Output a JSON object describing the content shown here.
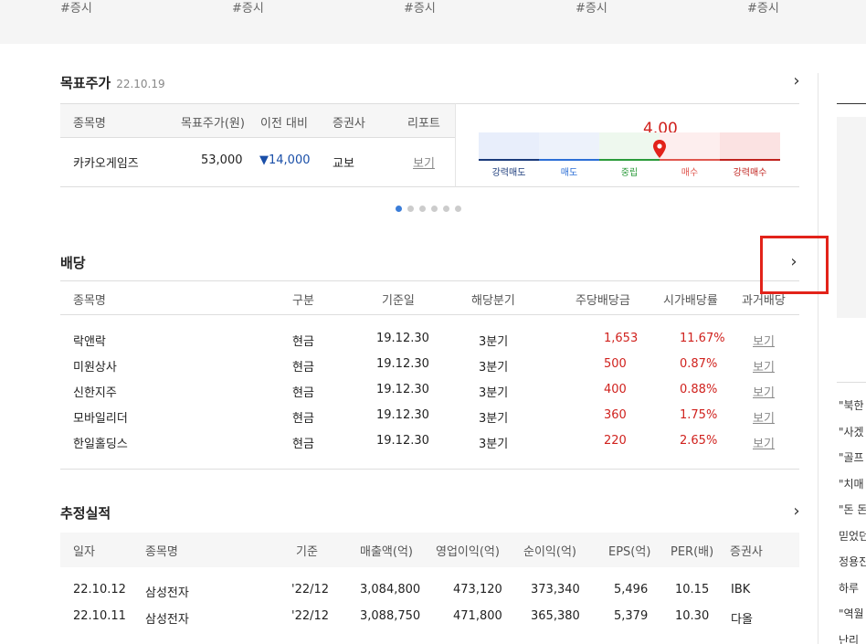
{
  "top_tags": [
    "#증시",
    "#증시",
    "#증시",
    "#증시",
    "#증시"
  ],
  "target_price": {
    "title": "목표주가",
    "date": "22.10.19",
    "columns": [
      "종목명",
      "목표주가(원)",
      "이전 대비",
      "증권사",
      "리포트"
    ],
    "row": {
      "name": "카카오게임즈",
      "target": "53,000",
      "change": "▼14,000",
      "broker": "교보",
      "report": "보기"
    },
    "gauge": {
      "value": "4.00",
      "value_num": 4.0,
      "labels": [
        "강력매도",
        "매도",
        "중립",
        "매수",
        "강력매수"
      ],
      "label_colors": [
        "#1a3a7a",
        "#2d6fd6",
        "#2a9a3a",
        "#e0574f",
        "#c0221e"
      ],
      "fill_colors": [
        "#e8eefb",
        "#edf2fb",
        "#eef8ee",
        "#fdeeee",
        "#fbe2e2"
      ]
    },
    "pager_dots": 6
  },
  "dividend": {
    "title": "배당",
    "columns": [
      "종목명",
      "구분",
      "기준일",
      "해당분기",
      "주당배당금",
      "시가배당률",
      "과거배당"
    ],
    "rows": [
      {
        "name": "락앤락",
        "type": "현금",
        "date": "19.12.30",
        "quarter": "3분기",
        "dps": "1,653",
        "yield": "11.67%",
        "past": "보기"
      },
      {
        "name": "미원상사",
        "type": "현금",
        "date": "19.12.30",
        "quarter": "3분기",
        "dps": "500",
        "yield": "0.87%",
        "past": "보기"
      },
      {
        "name": "신한지주",
        "type": "현금",
        "date": "19.12.30",
        "quarter": "3분기",
        "dps": "400",
        "yield": "0.88%",
        "past": "보기"
      },
      {
        "name": "모바일리더",
        "type": "현금",
        "date": "19.12.30",
        "quarter": "3분기",
        "dps": "360",
        "yield": "1.75%",
        "past": "보기"
      },
      {
        "name": "한일홀딩스",
        "type": "현금",
        "date": "19.12.30",
        "quarter": "3분기",
        "dps": "220",
        "yield": "2.65%",
        "past": "보기"
      }
    ]
  },
  "estimates": {
    "title": "추정실적",
    "columns": [
      "일자",
      "종목명",
      "기준",
      "매출액(억)",
      "영업이익(억)",
      "순이익(억)",
      "EPS(억)",
      "PER(배)",
      "증권사"
    ],
    "rows": [
      {
        "date": "22.10.12",
        "name": "삼성전자",
        "basis": "'22/12",
        "sales": "3,084,800",
        "op": "473,120",
        "net": "373,340",
        "eps": "5,496",
        "per": "10.15",
        "broker": "IBK"
      },
      {
        "date": "22.10.11",
        "name": "삼성전자",
        "basis": "'22/12",
        "sales": "3,088,750",
        "op": "471,800",
        "net": "365,380",
        "eps": "5,379",
        "per": "10.30",
        "broker": "다올"
      }
    ]
  },
  "right_panel": {
    "items": [
      "\"북한",
      "\"사겠",
      "\"골프",
      "\"치매",
      "\"돈 돈",
      "믿었던",
      "정용진",
      "하루",
      "\"역월",
      "난리"
    ]
  },
  "chevron": "›"
}
